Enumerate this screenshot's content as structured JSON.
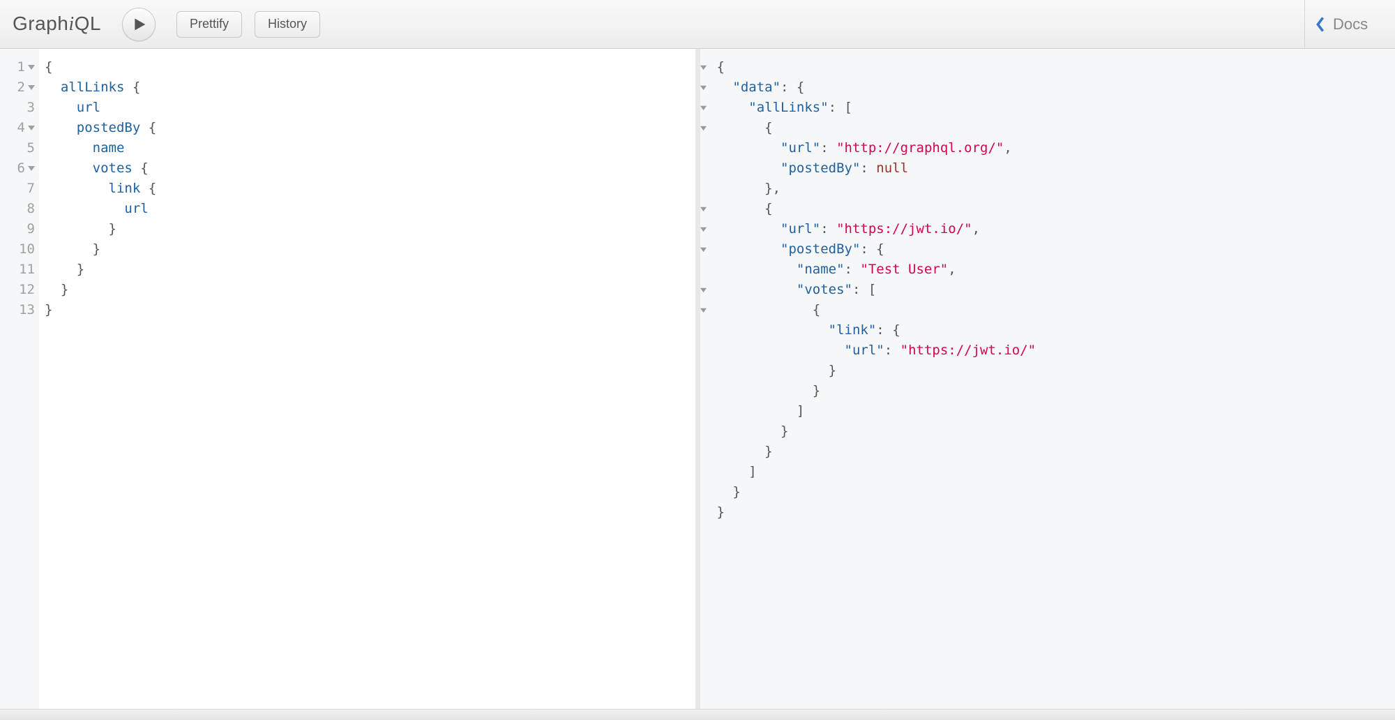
{
  "app": {
    "logo_prefix": "Graph",
    "logo_i": "i",
    "logo_suffix": "QL"
  },
  "toolbar": {
    "prettify_label": "Prettify",
    "history_label": "History",
    "docs_label": "Docs"
  },
  "editor": {
    "line_count": 13,
    "foldable_lines": [
      1,
      2,
      4,
      6
    ],
    "query_tokens": [
      [
        {
          "t": "brace",
          "v": "{"
        }
      ],
      [
        {
          "t": "indent",
          "v": "  "
        },
        {
          "t": "attr",
          "v": "allLinks"
        },
        {
          "t": "sp",
          "v": " "
        },
        {
          "t": "brace",
          "v": "{"
        }
      ],
      [
        {
          "t": "indent",
          "v": "    "
        },
        {
          "t": "attr",
          "v": "url"
        }
      ],
      [
        {
          "t": "indent",
          "v": "    "
        },
        {
          "t": "attr",
          "v": "postedBy"
        },
        {
          "t": "sp",
          "v": " "
        },
        {
          "t": "brace",
          "v": "{"
        }
      ],
      [
        {
          "t": "indent",
          "v": "      "
        },
        {
          "t": "attr",
          "v": "name"
        }
      ],
      [
        {
          "t": "indent",
          "v": "      "
        },
        {
          "t": "attr",
          "v": "votes"
        },
        {
          "t": "sp",
          "v": " "
        },
        {
          "t": "brace",
          "v": "{"
        }
      ],
      [
        {
          "t": "indent",
          "v": "        "
        },
        {
          "t": "attr",
          "v": "link"
        },
        {
          "t": "sp",
          "v": " "
        },
        {
          "t": "brace",
          "v": "{"
        }
      ],
      [
        {
          "t": "indent",
          "v": "          "
        },
        {
          "t": "attr",
          "v": "url"
        }
      ],
      [
        {
          "t": "indent",
          "v": "        "
        },
        {
          "t": "brace",
          "v": "}"
        }
      ],
      [
        {
          "t": "indent",
          "v": "      "
        },
        {
          "t": "brace",
          "v": "}"
        }
      ],
      [
        {
          "t": "indent",
          "v": "    "
        },
        {
          "t": "brace",
          "v": "}"
        }
      ],
      [
        {
          "t": "indent",
          "v": "  "
        },
        {
          "t": "brace",
          "v": "}"
        }
      ],
      [
        {
          "t": "brace",
          "v": "}"
        }
      ]
    ]
  },
  "result": {
    "fold_rows": [
      1,
      2,
      3,
      4,
      8,
      9,
      10,
      12,
      13
    ],
    "tokens": [
      [
        {
          "t": "brace",
          "v": "{"
        }
      ],
      [
        {
          "t": "indent",
          "v": "  "
        },
        {
          "t": "key",
          "v": "\"data\""
        },
        {
          "t": "punc",
          "v": ": "
        },
        {
          "t": "brace",
          "v": "{"
        }
      ],
      [
        {
          "t": "indent",
          "v": "    "
        },
        {
          "t": "key",
          "v": "\"allLinks\""
        },
        {
          "t": "punc",
          "v": ": ["
        }
      ],
      [
        {
          "t": "indent",
          "v": "      "
        },
        {
          "t": "brace",
          "v": "{"
        }
      ],
      [
        {
          "t": "indent",
          "v": "        "
        },
        {
          "t": "key",
          "v": "\"url\""
        },
        {
          "t": "punc",
          "v": ": "
        },
        {
          "t": "str",
          "v": "\"http://graphql.org/\""
        },
        {
          "t": "punc",
          "v": ","
        }
      ],
      [
        {
          "t": "indent",
          "v": "        "
        },
        {
          "t": "key",
          "v": "\"postedBy\""
        },
        {
          "t": "punc",
          "v": ": "
        },
        {
          "t": "null",
          "v": "null"
        }
      ],
      [
        {
          "t": "indent",
          "v": "      "
        },
        {
          "t": "brace",
          "v": "},"
        }
      ],
      [
        {
          "t": "indent",
          "v": "      "
        },
        {
          "t": "brace",
          "v": "{"
        }
      ],
      [
        {
          "t": "indent",
          "v": "        "
        },
        {
          "t": "key",
          "v": "\"url\""
        },
        {
          "t": "punc",
          "v": ": "
        },
        {
          "t": "str",
          "v": "\"https://jwt.io/\""
        },
        {
          "t": "punc",
          "v": ","
        }
      ],
      [
        {
          "t": "indent",
          "v": "        "
        },
        {
          "t": "key",
          "v": "\"postedBy\""
        },
        {
          "t": "punc",
          "v": ": "
        },
        {
          "t": "brace",
          "v": "{"
        }
      ],
      [
        {
          "t": "indent",
          "v": "          "
        },
        {
          "t": "key",
          "v": "\"name\""
        },
        {
          "t": "punc",
          "v": ": "
        },
        {
          "t": "str",
          "v": "\"Test User\""
        },
        {
          "t": "punc",
          "v": ","
        }
      ],
      [
        {
          "t": "indent",
          "v": "          "
        },
        {
          "t": "key",
          "v": "\"votes\""
        },
        {
          "t": "punc",
          "v": ": ["
        }
      ],
      [
        {
          "t": "indent",
          "v": "            "
        },
        {
          "t": "brace",
          "v": "{"
        }
      ],
      [
        {
          "t": "indent",
          "v": "              "
        },
        {
          "t": "key",
          "v": "\"link\""
        },
        {
          "t": "punc",
          "v": ": "
        },
        {
          "t": "brace",
          "v": "{"
        }
      ],
      [
        {
          "t": "indent",
          "v": "                "
        },
        {
          "t": "key",
          "v": "\"url\""
        },
        {
          "t": "punc",
          "v": ": "
        },
        {
          "t": "str",
          "v": "\"https://jwt.io/\""
        }
      ],
      [
        {
          "t": "indent",
          "v": "              "
        },
        {
          "t": "brace",
          "v": "}"
        }
      ],
      [
        {
          "t": "indent",
          "v": "            "
        },
        {
          "t": "brace",
          "v": "}"
        }
      ],
      [
        {
          "t": "indent",
          "v": "          "
        },
        {
          "t": "punc",
          "v": "]"
        }
      ],
      [
        {
          "t": "indent",
          "v": "        "
        },
        {
          "t": "brace",
          "v": "}"
        }
      ],
      [
        {
          "t": "indent",
          "v": "      "
        },
        {
          "t": "brace",
          "v": "}"
        }
      ],
      [
        {
          "t": "indent",
          "v": "    "
        },
        {
          "t": "punc",
          "v": "]"
        }
      ],
      [
        {
          "t": "indent",
          "v": "  "
        },
        {
          "t": "brace",
          "v": "}"
        }
      ],
      [
        {
          "t": "brace",
          "v": "}"
        }
      ]
    ]
  }
}
